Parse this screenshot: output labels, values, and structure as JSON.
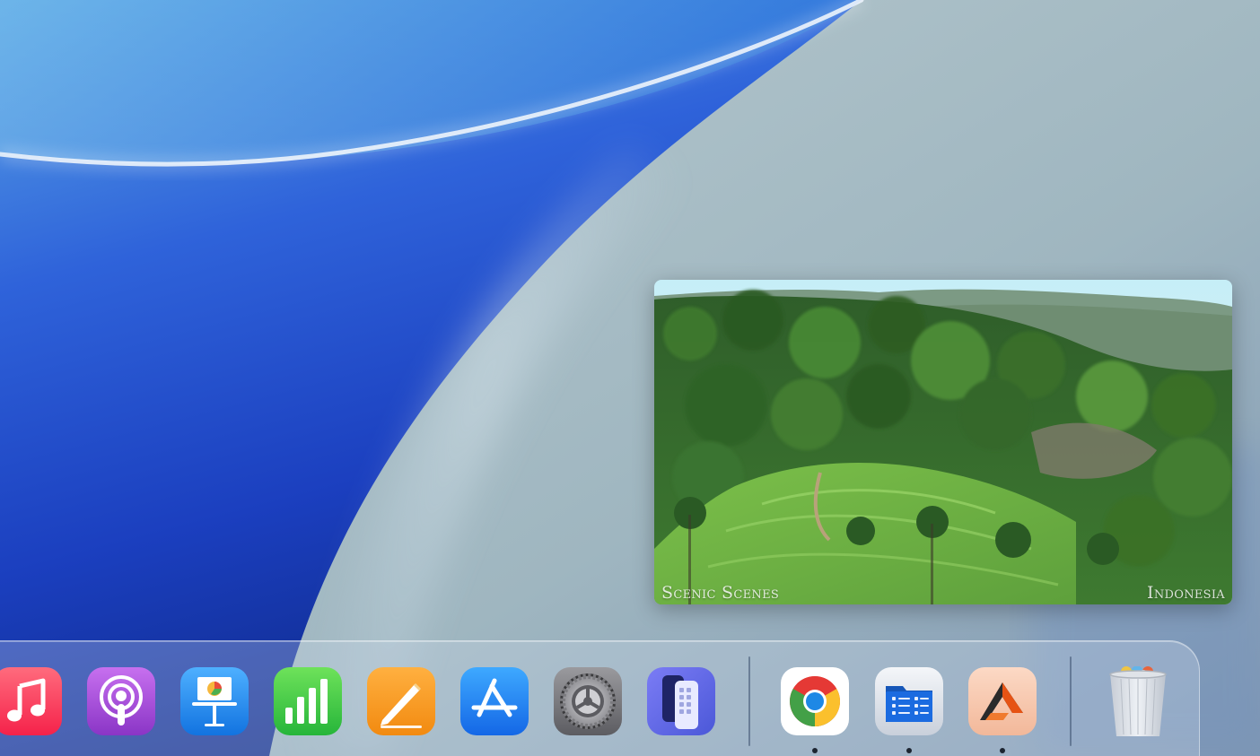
{
  "pip_video": {
    "caption_left": "Scenic Scenes",
    "caption_right": "Indonesia"
  },
  "dock": {
    "apps": [
      {
        "icon": "music-icon",
        "running": false
      },
      {
        "icon": "podcasts-icon",
        "running": false
      },
      {
        "icon": "keynote-icon",
        "running": false
      },
      {
        "icon": "numbers-icon",
        "running": false
      },
      {
        "icon": "pages-icon",
        "running": false
      },
      {
        "icon": "app-store-icon",
        "running": false
      },
      {
        "icon": "system-settings-icon",
        "running": false
      },
      {
        "icon": "iphone-mirroring-icon",
        "running": false
      },
      {
        "icon": "chrome-icon",
        "running": true
      },
      {
        "icon": "file-manager-icon",
        "running": true
      },
      {
        "icon": "affinity-designer-icon",
        "running": true
      },
      {
        "icon": "trash-icon",
        "running": false
      }
    ]
  }
}
